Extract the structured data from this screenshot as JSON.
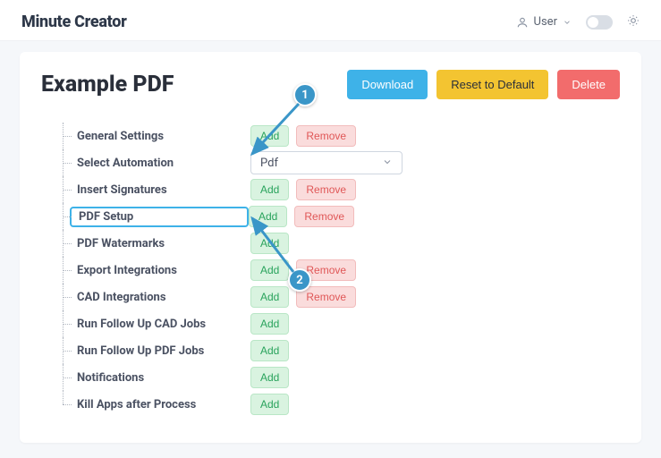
{
  "header": {
    "logo": "Minute Creator",
    "user_label": "User"
  },
  "page": {
    "title": "Example PDF",
    "download": "Download",
    "reset": "Reset to Default",
    "delete": "Delete"
  },
  "tree": [
    {
      "label": "General Settings",
      "add": "Add",
      "remove": "Remove",
      "show_remove": true,
      "highlight": false
    },
    {
      "label": "Select Automation",
      "select_value": "Pdf",
      "show_remove": false,
      "highlight": false
    },
    {
      "label": "Insert Signatures",
      "add": "Add",
      "remove": "Remove",
      "show_remove": true,
      "highlight": false
    },
    {
      "label": "PDF Setup",
      "add": "Add",
      "remove": "Remove",
      "show_remove": true,
      "highlight": true
    },
    {
      "label": "PDF Watermarks",
      "add": "Add",
      "show_remove": false,
      "highlight": false
    },
    {
      "label": "Export Integrations",
      "add": "Add",
      "remove": "Remove",
      "show_remove": true,
      "highlight": false
    },
    {
      "label": "CAD Integrations",
      "add": "Add",
      "remove": "Remove",
      "show_remove": true,
      "highlight": false
    },
    {
      "label": "Run Follow Up CAD Jobs",
      "add": "Add",
      "show_remove": false,
      "highlight": false
    },
    {
      "label": "Run Follow Up PDF Jobs",
      "add": "Add",
      "show_remove": false,
      "highlight": false
    },
    {
      "label": "Notifications",
      "add": "Add",
      "show_remove": false,
      "highlight": false
    },
    {
      "label": "Kill Apps after Process",
      "add": "Add",
      "show_remove": false,
      "highlight": false
    }
  ],
  "annotations": {
    "badge1": "1",
    "badge2": "2"
  }
}
